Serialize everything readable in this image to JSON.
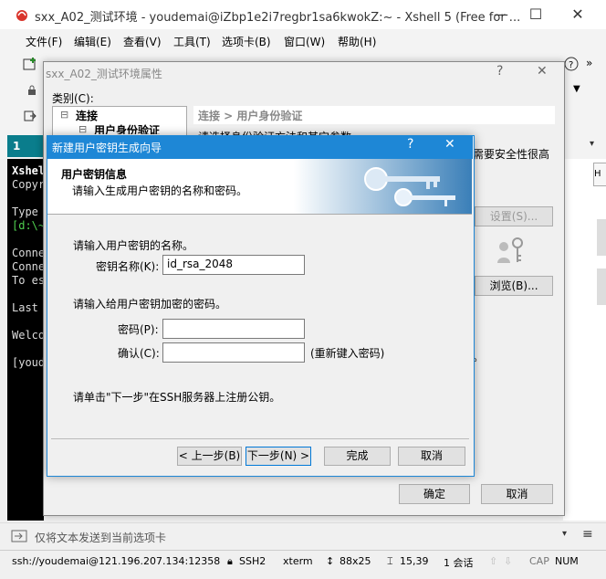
{
  "app": {
    "title": "sxx_A02_测试环境 - youdemai@iZbp1e2i7regbr1sa6kwokZ:~ - Xshell 5 (Free for ..."
  },
  "menu": [
    "文件(F)",
    "编辑(E)",
    "查看(V)",
    "工具(T)",
    "选项卡(B)",
    "窗口(W)",
    "帮助(H)"
  ],
  "tab": {
    "label": "1"
  },
  "terminal": {
    "lines": [
      "Xshel",
      "Copyr",
      "",
      "Type ",
      "[d:\\~",
      "",
      "Conne",
      "Conne",
      "To es",
      "",
      "Last ",
      "",
      "Welco",
      "",
      "[youd"
    ]
  },
  "properties": {
    "title": "sxx_A02_测试环境属性",
    "help": "?",
    "close": "✕",
    "category_label": "类别(C):",
    "tree": [
      {
        "label": "连接",
        "expand": "⊟"
      },
      {
        "label": "用户身份验证",
        "expand": "⊟"
      }
    ],
    "header": "连接 > 用户身份验证",
    "subheader": "请选择身份验证方法和其它参数",
    "right_clip": "需要安全性很高",
    "settings_button": "设置(S)...",
    "browse_button": "浏览(B)...",
    "dot": "。",
    "ok_button": "确定",
    "cancel_button": "取消"
  },
  "wizard": {
    "title": "新建用户密钥生成向导",
    "help": "?",
    "close": "✕",
    "banner_title": "用户密钥信息",
    "banner_sub": "请输入生成用户密钥的名称和密码。",
    "name_prompt": "请输入用户密钥的名称。",
    "key_name_label": "密钥名称(K):",
    "key_name_value": "id_rsa_2048",
    "pass_prompt": "请输入给用户密钥加密的密码。",
    "password_label": "密码(P):",
    "password_value": "",
    "confirm_label": "确认(C):",
    "confirm_value": "",
    "confirm_hint": "(重新键入密码)",
    "next_hint": "请单击\"下一步\"在SSH服务器上注册公钥。",
    "back_button": "< 上一步(B)",
    "next_button": "下一步(N) >",
    "finish_button": "完成",
    "cancel_button": "取消"
  },
  "sendbar": {
    "text": "仅将文本发送到当前选项卡"
  },
  "status": {
    "connection": "ssh://youdemai@121.196.207.134:12358",
    "protocol": "SSH2",
    "term": "xterm",
    "size": "88x25",
    "cursor": "15,39",
    "sessions": "1 会话",
    "cap": "CAP",
    "num": "NUM"
  },
  "colors": {
    "wizard_title": "#1e87d6",
    "tab_active": "#0a7d8c"
  }
}
